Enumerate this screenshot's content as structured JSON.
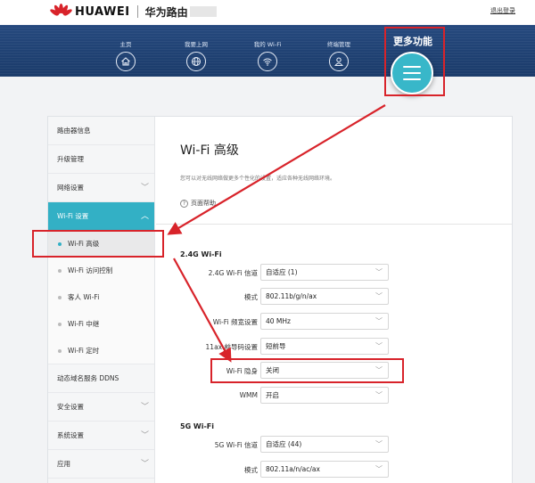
{
  "header": {
    "brand": "HUAWEI",
    "product": "华为路由",
    "logout": "退出登录"
  },
  "nav": {
    "items": [
      {
        "label": "主页",
        "icon": "home-icon"
      },
      {
        "label": "我要上网",
        "icon": "globe-icon"
      },
      {
        "label": "我的 Wi-Fi",
        "icon": "wifi-icon"
      },
      {
        "label": "终端管理",
        "icon": "user-icon"
      }
    ],
    "more_label": "更多功能",
    "more_icon": "menu-icon"
  },
  "sidebar": {
    "items": [
      {
        "label": "路由器信息"
      },
      {
        "label": "升级管理"
      },
      {
        "label": "网络设置",
        "chevron": "﹀"
      },
      {
        "label": "Wi-Fi 设置",
        "chevron": "︿"
      },
      {
        "label": "动态域名服务 DDNS"
      },
      {
        "label": "安全设置",
        "chevron": "﹀"
      },
      {
        "label": "系统设置",
        "chevron": "﹀"
      },
      {
        "label": "应用",
        "chevron": "﹀"
      }
    ],
    "sub_items": [
      {
        "label": "Wi-Fi 高级"
      },
      {
        "label": "Wi-Fi 访问控制"
      },
      {
        "label": "客人 Wi-Fi"
      },
      {
        "label": "Wi-Fi 中继"
      },
      {
        "label": "Wi-Fi 定时"
      }
    ]
  },
  "main": {
    "title": "Wi-Fi 高级",
    "description": "您可以对无线网络做更多个性化的设置，适应各种无线网络环境。",
    "help_icon": "?",
    "help": "页面帮助",
    "section_24": "2.4G Wi-Fi",
    "rows_24": [
      {
        "label": "2.4G Wi-Fi 信道",
        "value": "自适应 (1)"
      },
      {
        "label": "模式",
        "value": "802.11b/g/n/ax"
      },
      {
        "label": "Wi-Fi 频宽设置",
        "value": "40 MHz"
      },
      {
        "label": "11ax 前导码设置",
        "value": "短前导"
      },
      {
        "label": "Wi-Fi 隐身",
        "value": "关闭"
      },
      {
        "label": "WMM",
        "value": "开启"
      }
    ],
    "section_5": "5G Wi-Fi",
    "rows_5": [
      {
        "label": "5G Wi-Fi 信道",
        "value": "自适应 (44)"
      },
      {
        "label": "模式",
        "value": "802.11a/n/ac/ax"
      }
    ],
    "select_arrow": "﹀"
  },
  "colors": {
    "accent": "#33b0c5",
    "nav_bg": "#1f4273",
    "highlight": "#d8232a"
  }
}
